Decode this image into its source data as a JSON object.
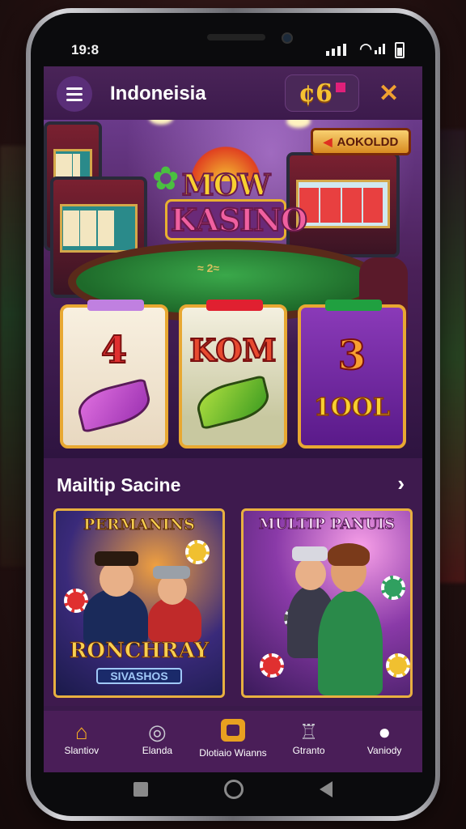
{
  "status": {
    "time": "19:8",
    "wifi_icon": "wifi-icon"
  },
  "header": {
    "title": "Indoneisia",
    "coins": "¢6",
    "menu_icon": "hamburger-menu-icon",
    "close_icon": "close-icon"
  },
  "hero": {
    "logo_line1": "MOW",
    "logo_line2": "KASINO",
    "promo_badge": "AOKOLDD",
    "table_text": "≈ 2≈",
    "reels": [
      {
        "top": "4",
        "bottom_symbol": "purple-leaf-symbol"
      },
      {
        "top": "KOM",
        "bottom_symbol": "green-leaf-symbol"
      },
      {
        "top": "3",
        "bottom": "1OOL"
      }
    ]
  },
  "section": {
    "title": "Mailtip Sacine",
    "chevron_icon": "chevron-right-icon"
  },
  "cards": [
    {
      "title": "PERMANINS",
      "foot1": "RONCHRAY",
      "foot2": "SIVASHOS"
    },
    {
      "title": "MULTIP PANUIS"
    }
  ],
  "bottom_nav": [
    {
      "label": "Slantiov",
      "icon": "home-icon"
    },
    {
      "label": "Elanda",
      "icon": "roulette-icon"
    },
    {
      "label": "Dlotiaio Wianns",
      "icon": "slots-icon"
    },
    {
      "label": "Gtranto",
      "icon": "trophy-icon"
    },
    {
      "label": "Vaniody",
      "icon": "user-icon"
    }
  ],
  "colors": {
    "accent": "#f8b020",
    "background": "#3e1a4e",
    "gold": "#e8b040"
  }
}
